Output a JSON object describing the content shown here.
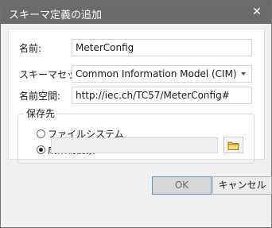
{
  "window": {
    "title": "スキーマ定義の追加",
    "close_label": "✕"
  },
  "form": {
    "name_label": "名前:",
    "name_value": "MeterConfig",
    "schema_set_label": "スキーマセット:",
    "schema_set_value": "Common Information Model (CIM)",
    "namespace_label": "名前空間:",
    "namespace_value": "http://iec.ch/TC57/MeterConfig#"
  },
  "save_location": {
    "group_title": "保存先",
    "options": [
      {
        "label": "ファイルシステム",
        "selected": false
      },
      {
        "label": "成果物要素",
        "selected": true
      }
    ],
    "path_value": ""
  },
  "buttons": {
    "ok_label": "OK",
    "cancel_label": "キャンセル"
  },
  "icons": {
    "close": "close-icon",
    "dropdown": "chevron-down-icon",
    "folder": "folder-icon"
  },
  "colors": {
    "titlebar": "#6b6b6b",
    "dialog_background": "#f0f0f0",
    "panel": "#ffffff",
    "default_button_border": "#6f8ec0"
  }
}
